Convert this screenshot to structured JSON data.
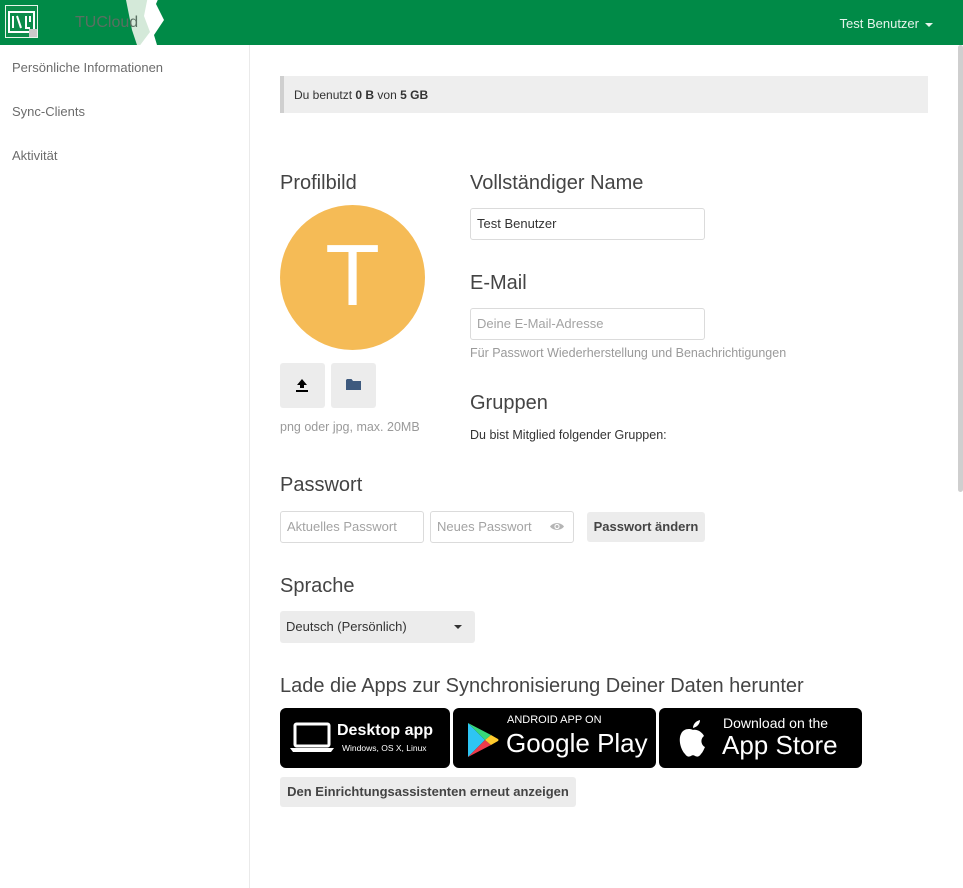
{
  "header": {
    "brand": "TUCloud",
    "user_name": "Test Benutzer",
    "accent_color": "#008a47"
  },
  "sidebar": {
    "items": [
      {
        "label": "Persönliche Informationen"
      },
      {
        "label": "Sync-Clients"
      },
      {
        "label": "Aktivität"
      }
    ]
  },
  "quota": {
    "prefix": "Du benutzt",
    "used": "0 B",
    "middle": "von",
    "total": "5 GB"
  },
  "profile_picture": {
    "heading": "Profilbild",
    "initial": "T",
    "avatar_color": "#f5bb56",
    "upload_icon": "upload-icon",
    "folder_icon": "folder-icon",
    "hint": "png oder jpg, max. 20MB"
  },
  "full_name": {
    "heading": "Vollständiger Name",
    "value": "Test Benutzer"
  },
  "email": {
    "heading": "E-Mail",
    "placeholder": "Deine E-Mail-Adresse",
    "hint": "Für Passwort Wiederherstellung und Benachrichtigungen"
  },
  "groups": {
    "heading": "Gruppen",
    "text": "Du bist Mitglied folgender Gruppen:"
  },
  "password": {
    "heading": "Passwort",
    "current_placeholder": "Aktuelles Passwort",
    "new_placeholder": "Neues Passwort",
    "change_button": "Passwort ändern"
  },
  "language": {
    "heading": "Sprache",
    "selected": "Deutsch (Persönlich)"
  },
  "apps": {
    "heading": "Lade die Apps zur Synchronisierung Deiner Daten herunter",
    "desktop_title": "Desktop app",
    "desktop_sub": "Windows, OS X, Linux",
    "android_top": "ANDROID APP ON",
    "android_main": "Google Play",
    "ios_top": "Download on the",
    "ios_main": "App Store",
    "wizard_button": "Den Einrichtungsassistenten erneut anzeigen"
  }
}
